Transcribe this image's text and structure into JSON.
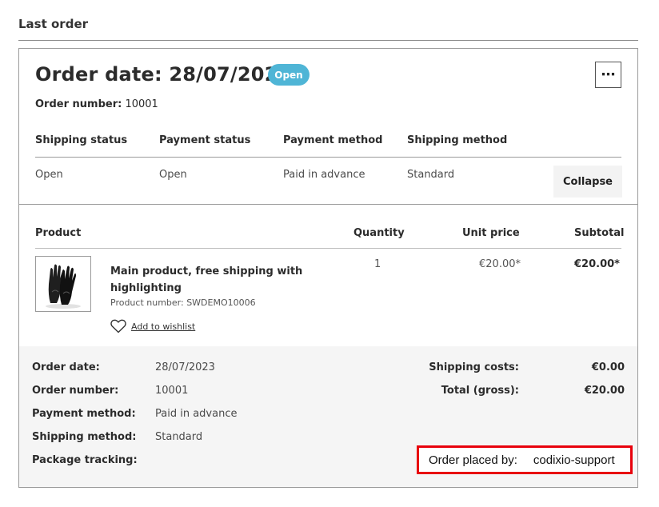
{
  "section_title": "Last order",
  "order": {
    "title": "Order date: 28/07/2023",
    "status_badge": "Open",
    "number_label": "Order number:",
    "number_value": "10001",
    "more_icon": "more-horizontal-icon"
  },
  "status_table": {
    "headers": [
      "Shipping status",
      "Payment status",
      "Payment method",
      "Shipping method"
    ],
    "values": [
      "Open",
      "Open",
      "Paid in advance",
      "Standard"
    ],
    "collapse_label": "Collapse"
  },
  "products": {
    "headers": {
      "product": "Product",
      "quantity": "Quantity",
      "unit_price": "Unit price",
      "subtotal": "Subtotal"
    },
    "items": [
      {
        "name": "Main product, free shipping with highlighting",
        "product_number": "Product number: SWDEMO10006",
        "quantity": "1",
        "unit_price": "€20.00*",
        "subtotal": "€20.00*",
        "image_icon": "gloves-image",
        "wishlist_label": "Add to wishlist",
        "wishlist_icon": "heart-icon"
      }
    ]
  },
  "summary": {
    "left": [
      {
        "label": "Order date:",
        "value": "28/07/2023"
      },
      {
        "label": "Order number:",
        "value": "10001"
      },
      {
        "label": "Payment method:",
        "value": "Paid in advance"
      },
      {
        "label": "Shipping method:",
        "value": "Standard"
      },
      {
        "label": "Package tracking:",
        "value": ""
      }
    ],
    "costs": [
      {
        "label": "Shipping costs:",
        "value": "€0.00"
      },
      {
        "label": "Total (gross):",
        "value": "€20.00"
      }
    ],
    "placed_by_label": "Order placed by:",
    "placed_by_value": "codixio-support"
  },
  "colors": {
    "badge": "#4fb5d6",
    "highlight_border": "#e8000b",
    "summary_bg": "#f5f5f5"
  }
}
